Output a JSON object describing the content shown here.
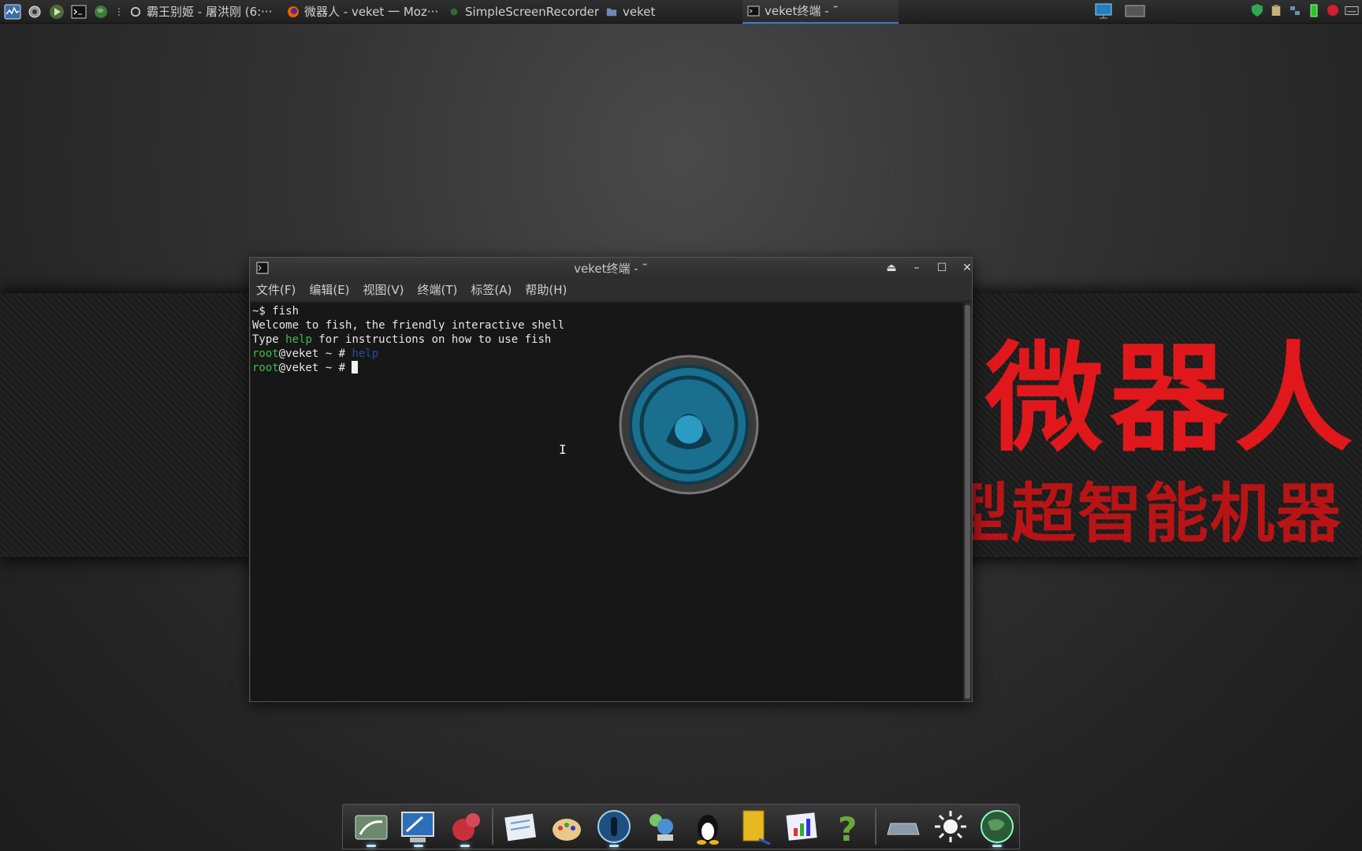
{
  "top_panel": {
    "tasks": [
      {
        "label": "霸王别姬 - 屠洪刚 (6:···",
        "icon": "music-player-icon"
      },
      {
        "label": "微器人 - veket 一 Moz···",
        "icon": "firefox-icon"
      },
      {
        "label": "SimpleScreenRecorder",
        "icon": "screen-recorder-icon"
      },
      {
        "label": "veket",
        "icon": "folder-icon"
      },
      {
        "label": "veket终端 - ˜",
        "icon": "terminal-icon",
        "active": true
      }
    ]
  },
  "wallpaper": {
    "title": "微器人",
    "subtitle": "微型超智能机器"
  },
  "terminal": {
    "title": "veket终端 - ˜",
    "menu": [
      "文件(F)",
      "编辑(E)",
      "视图(V)",
      "终端(T)",
      "标签(A)",
      "帮助(H)"
    ],
    "lines": {
      "l1": "~$ fish",
      "l2": "Welcome to fish, the friendly interactive shell",
      "l3_pre": "Type ",
      "l3_help": "help",
      "l3_post": " for instructions on how to use fish",
      "prompt_user": "root",
      "prompt_host": "@veket",
      "prompt_sep": " ~ # ",
      "l4_cmd": "help"
    }
  },
  "colors": {
    "accent": "#3a7bd5",
    "prompt_green": "#3fbf3f",
    "wallpaper_red": "#e0181b"
  },
  "dock": {
    "items": [
      "file-manager-icon",
      "computer-settings-icon",
      "squirrel-app-icon",
      "text-editor-icon",
      "paint-icon",
      "media-player-icon",
      "network-icon",
      "tux-icon",
      "notebook-icon",
      "chart-app-icon",
      "help-icon",
      "drive-icon",
      "brightness-icon",
      "globe-icon"
    ]
  }
}
